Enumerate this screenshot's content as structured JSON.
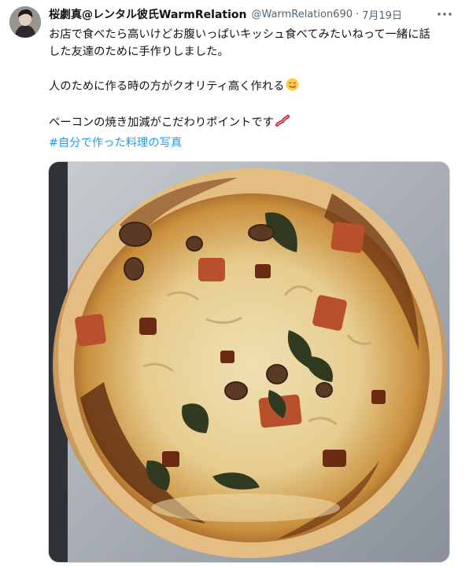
{
  "tweet": {
    "author": {
      "display_name": "桜劇真@レンタル彼氏WarmRelation",
      "handle": "@WarmRelation690",
      "separator": "·",
      "date": "7月19日"
    },
    "text_lines": [
      "お店で食べたら高いけどお腹いっぱいキッシュ食べてみたいねって一緒に話",
      "した友達のために手作りしました。",
      "人のために作る時の方がクオリティ高く作れる",
      "ベーコンの焼き加減がこだわりポイントです"
    ],
    "emojis": [
      "smiling-face-savoring-food-emoji",
      "bacon-emoji"
    ],
    "hashtag": "#自分で作った料理の写真",
    "image": {
      "subject": "homemade-quiche-photo"
    },
    "icons": [
      "avatar",
      "more-options-icon"
    ],
    "colors": {
      "link": "#1d9bf0",
      "secondary_text": "#536471",
      "primary_text": "#0f1419"
    }
  }
}
